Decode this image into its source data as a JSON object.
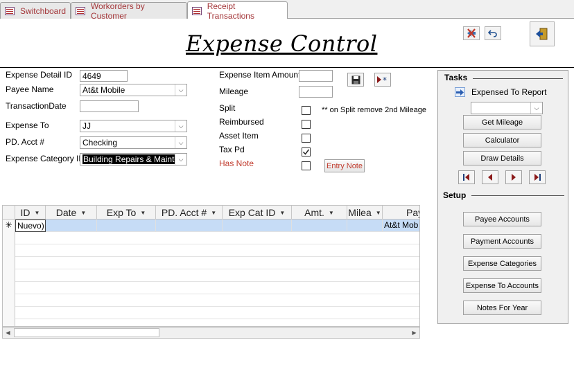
{
  "tabs": [
    {
      "label": "Switchboard"
    },
    {
      "label": "Workorders by Customer"
    },
    {
      "label": "Receipt Transactions"
    }
  ],
  "header": {
    "title": "Expense Control"
  },
  "form": {
    "expense_detail_id": {
      "label": "Expense Detail ID",
      "value": "4649"
    },
    "payee_name": {
      "label": "Payee Name",
      "value": "At&t Mobile"
    },
    "transaction_date": {
      "label": "TransactionDate",
      "value": ""
    },
    "expense_to": {
      "label": "Expense To",
      "value": "JJ"
    },
    "pd_acct": {
      "label": "PD. Acct #",
      "value": "Checking"
    },
    "expense_category_id": {
      "label": "Expense Category ID",
      "value": "Building Repairs & Maintenan"
    },
    "expense_item_amount": {
      "label": "Expense Item Amount",
      "value": ""
    },
    "mileage": {
      "label": "Mileage",
      "value": ""
    },
    "split": {
      "label": "Split",
      "checked": false
    },
    "split_note": "** on Split remove 2nd Mileage",
    "reimbursed": {
      "label": "Reimbursed",
      "checked": false
    },
    "asset_item": {
      "label": "Asset Item",
      "checked": false
    },
    "tax_pd": {
      "label": "Tax Pd",
      "checked": true
    },
    "has_note": {
      "label": "Has Note",
      "checked": false
    },
    "entry_note_button": "Entry Note"
  },
  "tasks": {
    "heading": "Tasks",
    "expensed_to_report": "Expensed To Report",
    "report_combo_value": "",
    "buttons": [
      "Get Mileage",
      "Calculator",
      "Draw Details"
    ],
    "setup_heading": "Setup",
    "setup_buttons": [
      "Payee Accounts",
      "Payment Accounts",
      "Expense Categories",
      "Expense To Accounts",
      "Notes For Year"
    ]
  },
  "grid": {
    "columns": [
      "ID",
      "Date",
      "Exp To",
      "PD. Acct #",
      "Exp Cat ID",
      "Amt.",
      "Milea",
      "Pay"
    ],
    "new_row": {
      "id": "Nuevo)",
      "payee": "At&t Mob"
    }
  },
  "colors": {
    "tab_text": "#a4373a",
    "has_note_label": "#c0392b",
    "new_row_bg": "#c6dcf6",
    "nav_arrow": "#8b1a1a"
  },
  "icons": [
    "undo-delete-icon",
    "undo-icon",
    "exit-door-icon",
    "save-icon",
    "new-record-icon",
    "arrow-right-icon",
    "first-record-icon",
    "previous-record-icon",
    "next-record-icon",
    "last-record-icon"
  ]
}
